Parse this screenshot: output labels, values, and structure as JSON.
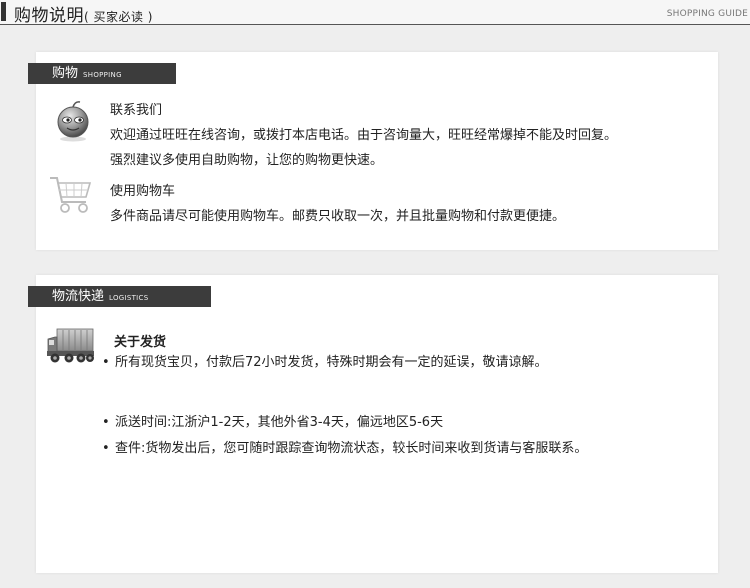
{
  "header": {
    "title": "购物说明",
    "subtitle": "( 买家必读 )",
    "english": "SHOPPING GUIDE"
  },
  "shopping": {
    "tab_label": "购物",
    "tab_english": "SHOPPING",
    "contact": {
      "title": "联系我们",
      "line1": "欢迎通过旺旺在线咨询，或拨打本店电话。由于咨询量大，旺旺经常爆掉不能及时回复。",
      "line2": "强烈建议多使用自助购物，让您的购物更快速。",
      "icon": "wangwang-icon"
    },
    "cart": {
      "title": "使用购物车",
      "line1": "多件商品请尽可能使用购物车。邮费只收取一次，并且批量购物和付款更便捷。",
      "icon": "shopping-cart-icon"
    }
  },
  "logistics": {
    "tab_label": "物流快递",
    "tab_english": "LOGISTICS",
    "shipping": {
      "title": "关于发货",
      "icon": "truck-icon",
      "items": [
        "所有现货宝贝，付款后72小时发货，特殊时期会有一定的延误，敬请谅解。",
        "派送时间:江浙沪1-2天，其他外省3-4天，偏远地区5-6天",
        "查件:货物发出后，您可随时跟踪查询物流状态，较长时间来收到货请与客服联系。"
      ],
      "bullet": "•"
    }
  }
}
